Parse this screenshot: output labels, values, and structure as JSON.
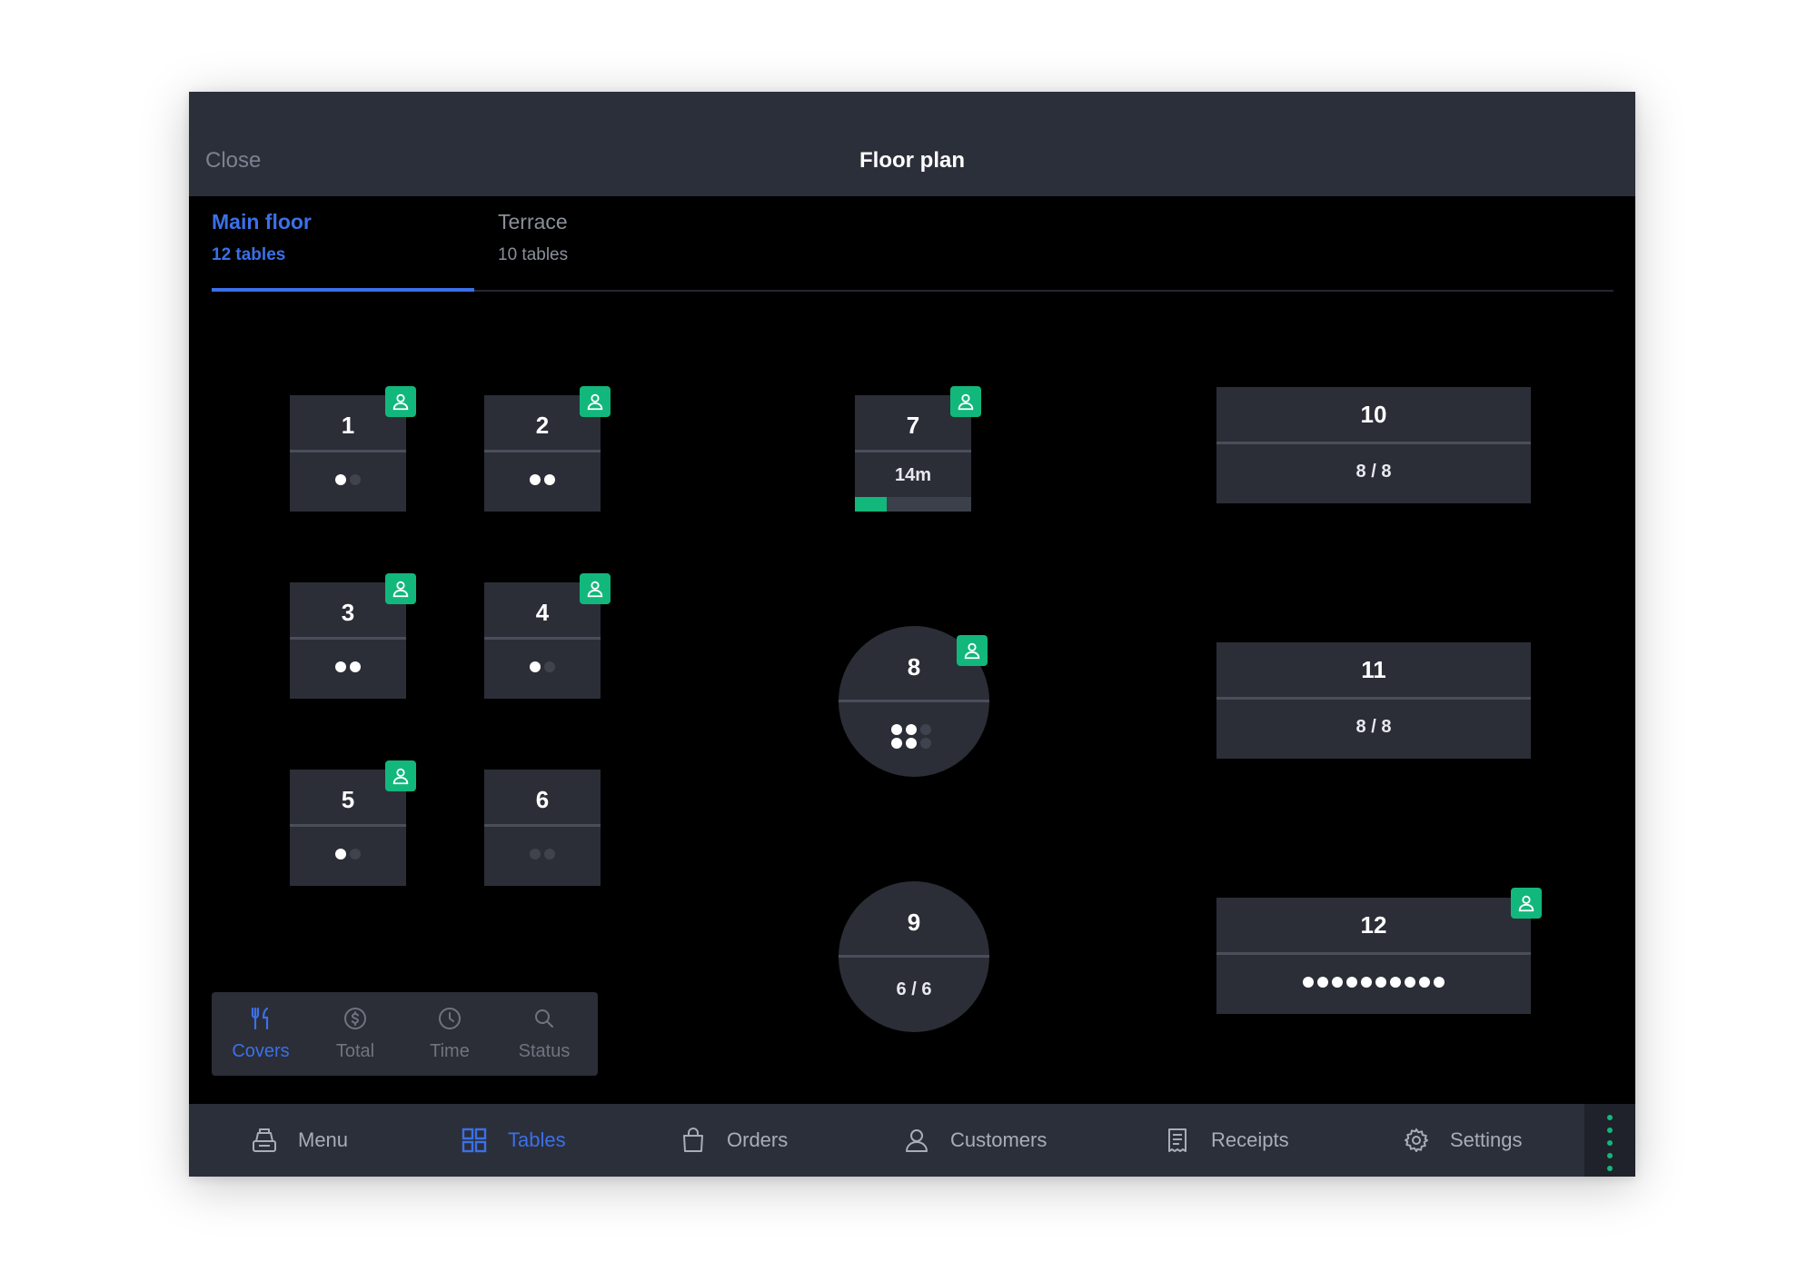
{
  "header": {
    "close_label": "Close",
    "title": "Floor plan"
  },
  "tabs": [
    {
      "name": "Main floor",
      "count": "12 tables",
      "active": true
    },
    {
      "name": "Terrace",
      "count": "10 tables",
      "active": false
    }
  ],
  "tables": {
    "t1": {
      "number": "1"
    },
    "t2": {
      "number": "2"
    },
    "t3": {
      "number": "3"
    },
    "t4": {
      "number": "4"
    },
    "t5": {
      "number": "5"
    },
    "t6": {
      "number": "6"
    },
    "t7": {
      "number": "7",
      "time": "14m",
      "progress": 0.27
    },
    "t8": {
      "number": "8"
    },
    "t9": {
      "number": "9",
      "covers": "6 / 6"
    },
    "t10": {
      "number": "10",
      "covers": "8 / 8"
    },
    "t11": {
      "number": "11",
      "covers": "8 / 8"
    },
    "t12": {
      "number": "12"
    }
  },
  "view_toolbar": {
    "covers": "Covers",
    "total": "Total",
    "time": "Time",
    "status": "Status",
    "active": "Covers"
  },
  "bottom_nav": {
    "menu": "Menu",
    "tables": "Tables",
    "orders": "Orders",
    "customers": "Customers",
    "receipts": "Receipts",
    "settings": "Settings",
    "active": "Tables"
  },
  "colors": {
    "accent_blue": "#3b70e8",
    "occupied_green": "#12b77c",
    "table_fill": "#2b2e37",
    "bar_fill": "#2b2f3a"
  },
  "icons": {
    "occupied_badge": "person-icon",
    "covers": "cutlery-icon",
    "total": "dollar-coin-icon",
    "time": "clock-icon",
    "status": "search-icon",
    "menu": "cash-register-icon",
    "tables": "grid-icon",
    "orders": "shopping-bag-icon",
    "customers": "person-icon",
    "receipts": "receipt-icon",
    "settings": "gear-icon",
    "more": "more-vertical-icon"
  }
}
